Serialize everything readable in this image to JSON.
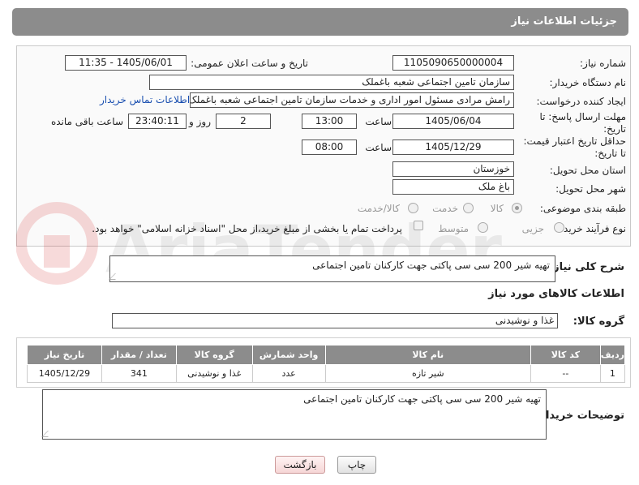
{
  "header": {
    "title": "جزئیات اطلاعات نیاز"
  },
  "form": {
    "need_number_label": "شماره نیاز:",
    "need_number": "1105090650000004",
    "announce_label": "تاریخ و ساعت اعلان عمومی:",
    "announce_value": "1405/06/01 - 11:35",
    "buyer_org_label": "نام دستگاه خریدار:",
    "buyer_org": "سازمان تامین اجتماعی شعبه باغملک",
    "creator_label": "ایجاد کننده درخواست:",
    "creator": "رامش مرادی مسئول امور اداری و خدمات سازمان تامین اجتماعی شعبه باغملک",
    "contact_link": "اطلاعات تماس خریدار",
    "reply_deadline_label": "مهلت ارسال پاسخ: تا تاریخ:",
    "reply_date": "1405/06/04",
    "time_label": "ساعت",
    "reply_time": "13:00",
    "days_value": "2",
    "days_label": "روز و",
    "remaining_time": "23:40:11",
    "remaining_label": "ساعت باقی مانده",
    "price_validity_label": "حداقل تاریخ اعتبار قیمت: تا تاریخ:",
    "price_date": "1405/12/29",
    "price_time": "08:00",
    "province_label": "استان محل تحویل:",
    "province": "خوزستان",
    "city_label": "شهر محل تحویل:",
    "city": "باغ ملک",
    "category_label": "طبقه بندی موضوعی:",
    "category_options": [
      "کالا",
      "خدمت",
      "کالا/خدمت"
    ],
    "process_label": "نوع فرآیند خرید :",
    "process_options": [
      "جزیی",
      "متوسط"
    ],
    "payment_note": "پرداخت تمام یا بخشی از مبلغ خرید،از محل \"اسناد خزانه اسلامی\" خواهد بود."
  },
  "description": {
    "label": "شرح کلی نیاز:",
    "text": "تهیه شیر 200 سی سی پاکتی جهت کارکنان تامین اجتماعی"
  },
  "goods_info_title": "اطلاعات کالاهای مورد نیاز",
  "goods_group": {
    "label": "گروه کالا:",
    "value": "غذا و نوشیدنی"
  },
  "table": {
    "headers": [
      "ردیف",
      "کد کالا",
      "نام کالا",
      "واحد شمارش",
      "گروه کالا",
      "تعداد / مقدار",
      "تاریخ نیاز"
    ],
    "rows": [
      [
        "1",
        "--",
        "شیر تازه",
        "عدد",
        "غذا و نوشیدنی",
        "341",
        "1405/12/29"
      ]
    ]
  },
  "buyer_notes": {
    "label": "توضیحات خریدار:",
    "text": "تهیه شیر 200 سی سی پاکتی جهت کارکنان تامین اجتماعی"
  },
  "buttons": {
    "print": "چاپ",
    "back": "بازگشت"
  },
  "watermark": "AriaTender.net"
}
